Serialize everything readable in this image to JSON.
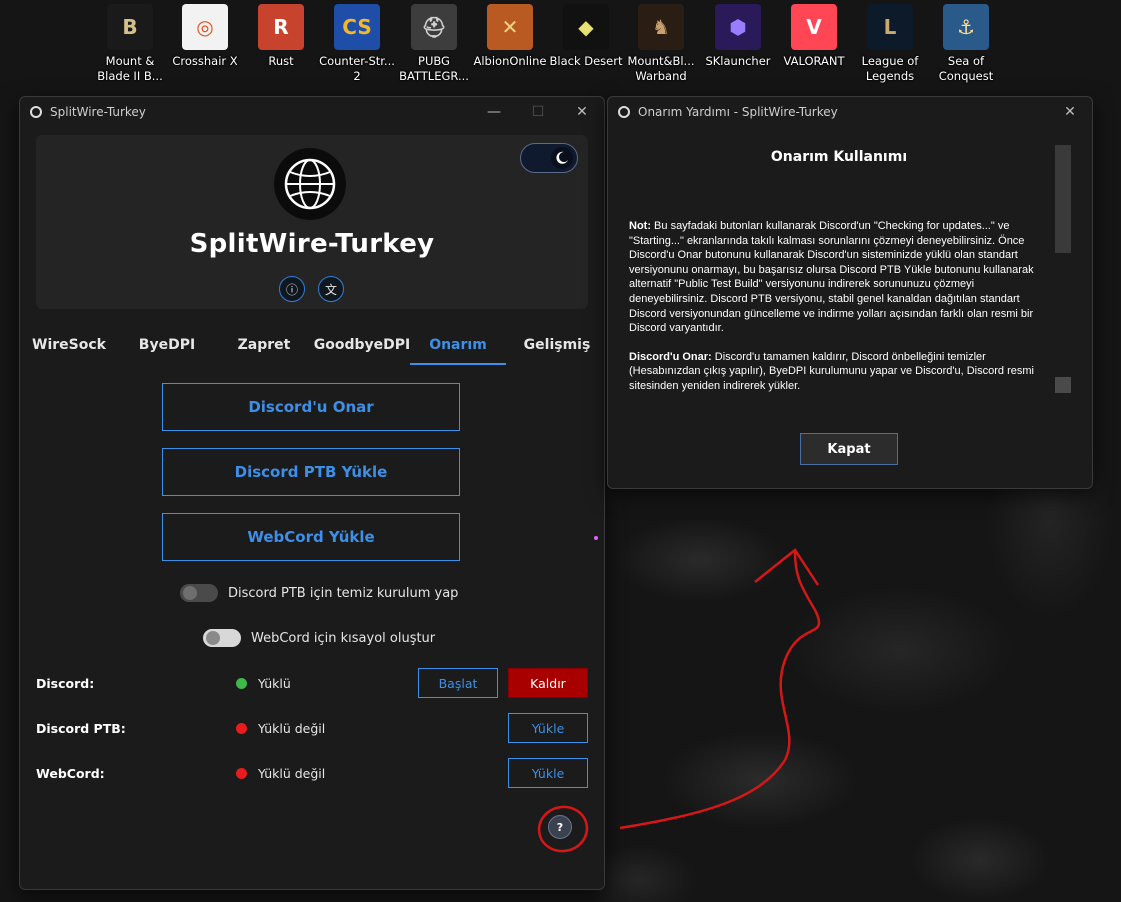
{
  "desktop": {
    "icons": [
      {
        "label": "Mount & Blade II B...",
        "glyph": "B",
        "bg": "#1a1a1a",
        "fg": "#d4c08a"
      },
      {
        "label": "Crosshair X",
        "glyph": "◎",
        "bg": "#f2f2f2",
        "fg": "#e0531f"
      },
      {
        "label": "Rust",
        "glyph": "R",
        "bg": "#c8432d",
        "fg": "#ffffff"
      },
      {
        "label": "Counter-Str... 2",
        "glyph": "CS",
        "bg": "#1e4ea8",
        "fg": "#f1b82d"
      },
      {
        "label": "PUBG BATTLEGR...",
        "glyph": "⛑",
        "bg": "#3d3d3d",
        "fg": "#d0d0d0"
      },
      {
        "label": "AlbionOnline",
        "glyph": "✕",
        "bg": "#b85a22",
        "fg": "#f4d38a"
      },
      {
        "label": "Black Desert",
        "glyph": "◆",
        "bg": "#111111",
        "fg": "#e8e070"
      },
      {
        "label": "Mount&Bl... Warband",
        "glyph": "♞",
        "bg": "#2a1e14",
        "fg": "#c8a070"
      },
      {
        "label": "SKlauncher",
        "glyph": "⬢",
        "bg": "#2a1a5a",
        "fg": "#9a7cff"
      },
      {
        "label": "VALORANT",
        "glyph": "V",
        "bg": "#ff4655",
        "fg": "#ffffff"
      },
      {
        "label": "League of Legends",
        "glyph": "L",
        "bg": "#0c1a2a",
        "fg": "#c8aa6e"
      },
      {
        "label": "Sea of Conquest",
        "glyph": "⚓",
        "bg": "#2a5a8a",
        "fg": "#ffe08a"
      }
    ]
  },
  "main_window": {
    "title": "SplitWire-Turkey",
    "brand": "SplitWire-Turkey",
    "tabs": [
      "WireSock",
      "ByeDPI",
      "Zapret",
      "GoodbyeDPI",
      "Onarım",
      "Gelişmiş"
    ],
    "active_tab": "Onarım",
    "actions": {
      "repair": "Discord'u Onar",
      "install_ptb": "Discord PTB Yükle",
      "install_webcord": "WebCord Yükle"
    },
    "toggles": {
      "clean_ptb": {
        "label": "Discord PTB için temiz kurulum yap",
        "state": "off"
      },
      "webcord_shortcut": {
        "label": "WebCord için kısayol oluştur",
        "state": "on"
      }
    },
    "status": [
      {
        "name": "Discord:",
        "state": "Yüklü",
        "color": "#3db84a",
        "buttons": [
          "Başlat",
          "Kaldır"
        ]
      },
      {
        "name": "Discord PTB:",
        "state": "Yüklü değil",
        "color": "#e81c1c",
        "buttons": [
          "Yükle"
        ]
      },
      {
        "name": "WebCord:",
        "state": "Yüklü değil",
        "color": "#e81c1c",
        "buttons": [
          "Yükle"
        ]
      }
    ],
    "help_glyph": "?",
    "accent": "#3d8fe8"
  },
  "help_window": {
    "title": "Onarım Yardımı - SplitWire-Turkey",
    "heading": "Onarım Kullanımı",
    "note_label": "Not:",
    "note_text": " Bu sayfadaki butonları kullanarak Discord'un \"Checking for updates...\" ve \"Starting...\" ekranlarında takılı kalması sorunlarını çözmeyi deneyebilirsiniz. Önce Discord'u Onar butonunu kullanarak Discord'un sisteminizde yüklü olan standart versiyonunu onarmayı, bu başarısız olursa Discord PTB Yükle butonunu kullanarak alternatif \"Public Test Build\" versiyonunu indirerek sorununuzu çözmeyi deneyebilirsiniz. Discord PTB versiyonu, stabil genel kanaldan dağıtılan standart Discord versiyonundan güncelleme ve indirme yolları açısından farklı olan resmi bir Discord varyantıdır.",
    "repair_label": "Discord'u Onar:",
    "repair_text": " Discord'u tamamen kaldırır, Discord önbelleğini temizler (Hesabınızdan çıkış yapılır), ByeDPI kurulumunu yapar ve Discord'u, Discord resmi sitesinden yeniden indirerek yükler.",
    "close_label": "Kapat"
  }
}
